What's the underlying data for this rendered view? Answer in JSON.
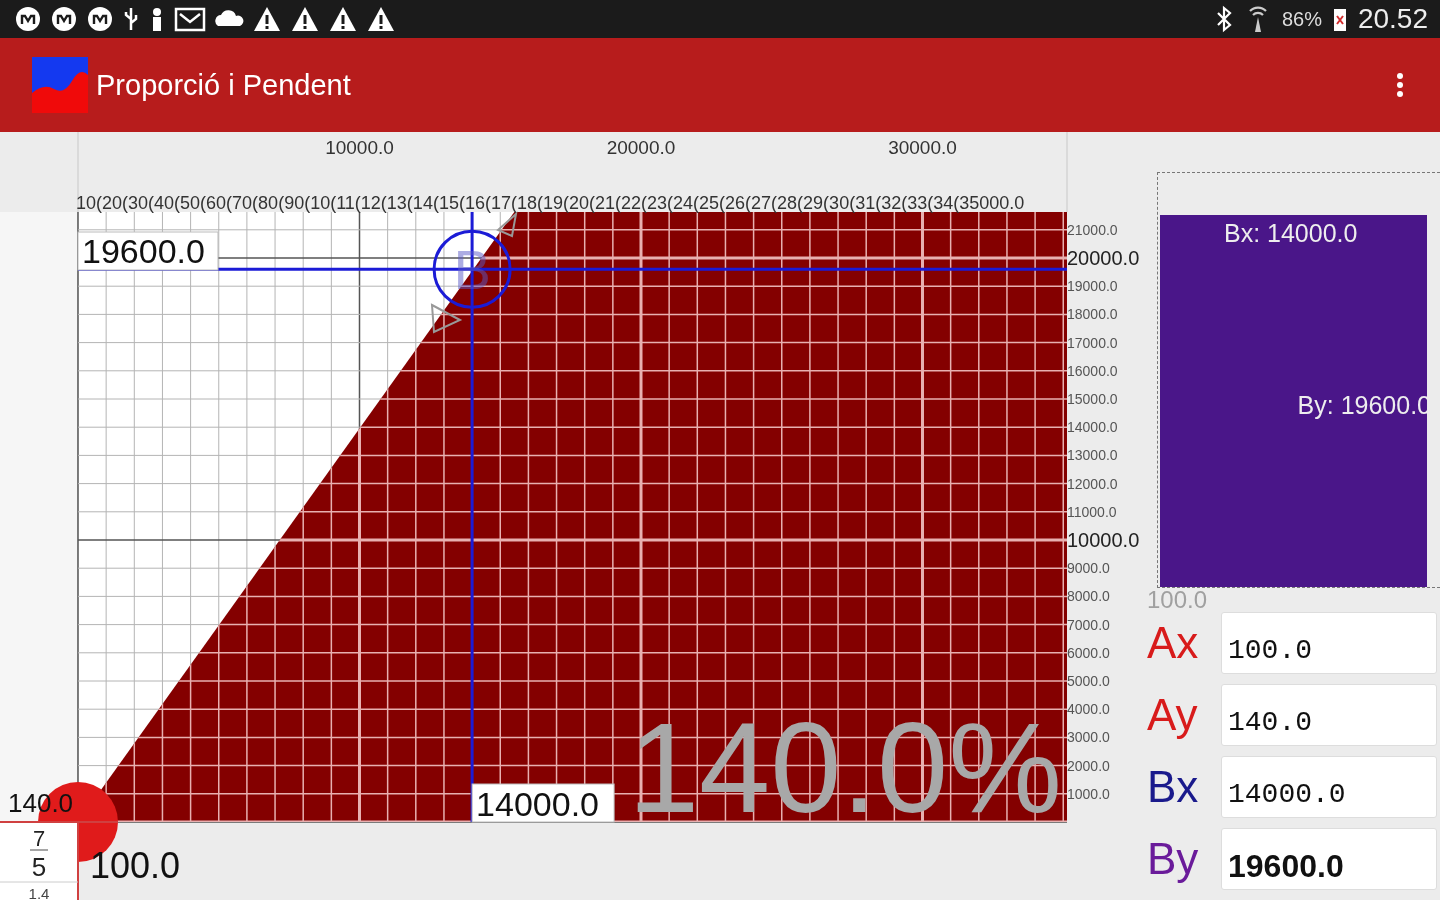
{
  "status_bar": {
    "battery": "86%",
    "time": "20.52"
  },
  "app_bar": {
    "title": "Proporció i Pendent"
  },
  "graph": {
    "x_axis_labels": [
      "10000.0",
      "20000.0",
      "30000.0"
    ],
    "x_ruler": "10(20(30(40(50(60(70(80(90(10(11(12(13(14(15(16(17(18(19(20(21(22(23(24(25(26(27(28(29(30(31(32(33(34(35000.0",
    "y_axis_labels": [
      {
        "label": "21000.0",
        "major": false
      },
      {
        "label": "20000.0",
        "major": true
      },
      {
        "label": "19000.0",
        "major": false
      },
      {
        "label": "18000.0",
        "major": false
      },
      {
        "label": "17000.0",
        "major": false
      },
      {
        "label": "16000.0",
        "major": false
      },
      {
        "label": "15000.0",
        "major": false
      },
      {
        "label": "14000.0",
        "major": false
      },
      {
        "label": "13000.0",
        "major": false
      },
      {
        "label": "12000.0",
        "major": false
      },
      {
        "label": "11000.0",
        "major": false
      },
      {
        "label": "10000.0",
        "major": true
      },
      {
        "label": "9000.0",
        "major": false
      },
      {
        "label": "8000.0",
        "major": false
      },
      {
        "label": "7000.0",
        "major": false
      },
      {
        "label": "6000.0",
        "major": false
      },
      {
        "label": "5000.0",
        "major": false
      },
      {
        "label": "4000.0",
        "major": false
      },
      {
        "label": "3000.0",
        "major": false
      },
      {
        "label": "2000.0",
        "major": false
      },
      {
        "label": "1000.0",
        "major": false
      }
    ],
    "point_b": {
      "label": "B",
      "y_value": "19600.0",
      "x_value": "14000.0"
    },
    "origin": {
      "y_value": "140.0",
      "x_value": "100.0"
    },
    "slope_percent": "140.0%",
    "ratio": {
      "numerator": "7",
      "denominator": "5",
      "decimal": "1.4"
    }
  },
  "summary": {
    "bx": "Bx: 14000.0",
    "by": "By: 19600.0",
    "ghost": "100.0"
  },
  "fields": [
    {
      "label": "Ax",
      "value": "100.0",
      "color": "#d81b1b",
      "focused": false
    },
    {
      "label": "Ay",
      "value": "140.0",
      "color": "#d81b1b",
      "focused": false
    },
    {
      "label": "Bx",
      "value": "14000.0",
      "color": "#1a1a8c",
      "focused": false
    },
    {
      "label": "By",
      "value": "19600.0",
      "color": "#6a1b9a",
      "focused": true
    }
  ]
}
